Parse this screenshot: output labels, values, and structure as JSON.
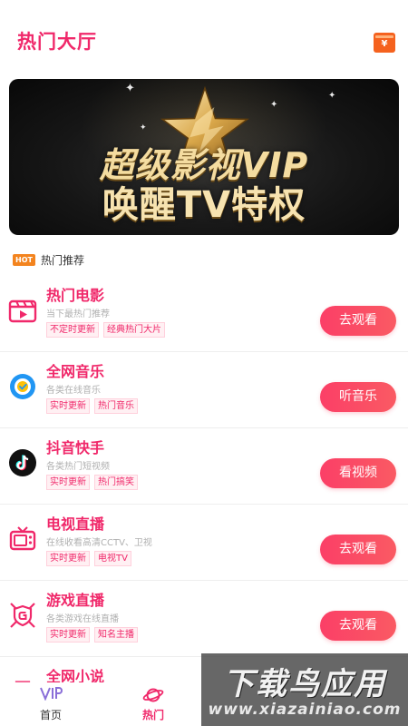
{
  "header": {
    "title": "热门大厅",
    "wallet_symbol": "¥",
    "icon": "wallet-icon"
  },
  "banner": {
    "line1": "超级影视VIP",
    "line2": "唤醒TV特权"
  },
  "section": {
    "badge": "HOT",
    "title": "热门推荐"
  },
  "items": [
    {
      "name": "热门电影",
      "desc": "当下最热门推荐",
      "tags": [
        "不定时更新",
        "经典热门大片"
      ],
      "button": "去观看",
      "icon": "movie-clapper-icon"
    },
    {
      "name": "全网音乐",
      "desc": "各类在线音乐",
      "tags": [
        "实时更新",
        "热门音乐"
      ],
      "button": "听音乐",
      "icon": "music-disc-icon"
    },
    {
      "name": "抖音快手",
      "desc": "各类热门短视频",
      "tags": [
        "实时更新",
        "热门搞笑"
      ],
      "button": "看视频",
      "icon": "tiktok-icon"
    },
    {
      "name": "电视直播",
      "desc": "在线收看高清CCTV、卫视",
      "tags": [
        "实时更新",
        "电视TV"
      ],
      "button": "去观看",
      "icon": "tv-icon"
    },
    {
      "name": "游戏直播",
      "desc": "各类游戏在线直播",
      "tags": [
        "实时更新",
        "知名主播"
      ],
      "button": "去观看",
      "icon": "game-shield-icon"
    },
    {
      "name": "全网小说",
      "icon": "book-icon"
    }
  ],
  "tabbar": {
    "tabs": [
      {
        "label": "首页",
        "icon": "vip-icon"
      },
      {
        "label": "热门",
        "icon": "planet-icon"
      }
    ]
  },
  "watermark": {
    "line1": "下载鸟应用",
    "line2": "www.xiazainiao.com"
  },
  "colors": {
    "accent": "#f0286a",
    "button": "#fb3f67",
    "hot_badge": "#f3841f",
    "wallet": "#f5621e"
  }
}
